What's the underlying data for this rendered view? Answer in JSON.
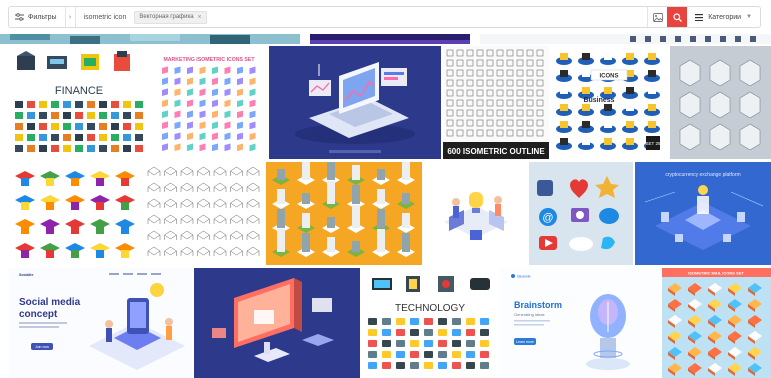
{
  "search": {
    "filters_label": "Фильтры",
    "query": "isometric icon",
    "chip_label": "Векторная графика",
    "categories_label": "Категории"
  },
  "tiles": {
    "finance": {
      "label": "FINANCE"
    },
    "marketing": {
      "label": "MARKETING ISOMETRIC ICONS SET"
    },
    "outline": {
      "label": "600 ISOMETRIC OUTLINE"
    },
    "business_icons": {
      "label_top": "ICONS",
      "label_mid": "Business",
      "badge": "SET 25"
    },
    "crypto": {
      "label": "cryptocurrency exchange platform"
    },
    "social": {
      "brand": "Socialite",
      "title_line1": "Social media",
      "title_line2": "concept",
      "button": "Join now"
    },
    "technology": {
      "label": "TECHNOLOGY"
    },
    "brainstorm": {
      "brand": "Ideanote",
      "title": "Brainstorm",
      "subtitle": "Generating ideas",
      "button": "Learn more"
    },
    "isometric_mail": {
      "label": "ISOMETRIC MAIL ICONS SET"
    }
  },
  "colors": {
    "accent": "#e8433e",
    "navy": "#2f3a8f",
    "orange": "#f5a623",
    "sky": "#2b7bd8"
  }
}
